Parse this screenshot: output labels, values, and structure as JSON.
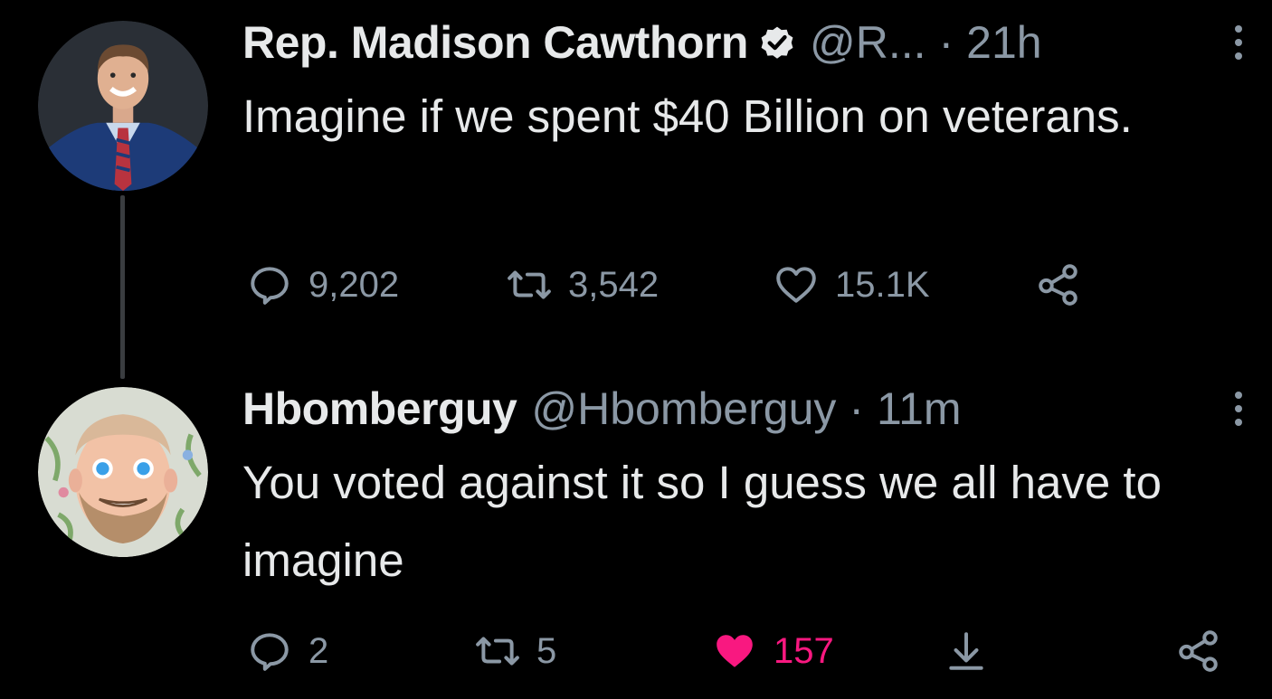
{
  "tweets": [
    {
      "author": "Rep. Madison Cawthorn",
      "verified": true,
      "handle": "@R...",
      "separator": "·",
      "time": "21h",
      "text": "Imagine if we spent $40 Billion on veterans.",
      "avatar_icon": "avatar-photo-man-suit",
      "actions": {
        "replies": "9,202",
        "retweets": "3,542",
        "likes": "15.1K"
      }
    },
    {
      "author": "Hbomberguy",
      "verified": false,
      "handle": "@Hbomberguy",
      "separator": "·",
      "time": "11m",
      "text": "You voted against it so I guess we all have to imagine",
      "avatar_icon": "avatar-cartoon-face",
      "actions": {
        "replies": "2",
        "retweets": "5",
        "likes": "157",
        "liked": true
      }
    }
  ],
  "colors": {
    "background": "#000000",
    "primary_text": "#e7e9ea",
    "secondary_text": "#8b98a5",
    "like_active": "#f91880"
  }
}
